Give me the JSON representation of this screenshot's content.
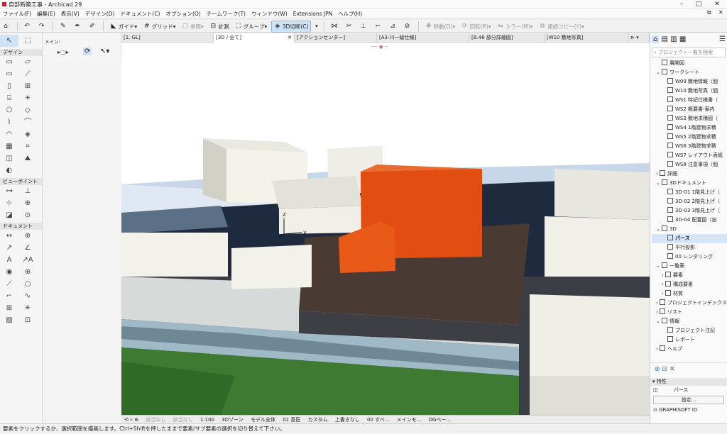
{
  "window": {
    "title": "自部新築工事 - Archicad 29",
    "min": "–",
    "max": "□",
    "close": "✕"
  },
  "menu": [
    "ファイル(F)",
    "編集(E)",
    "表示(V)",
    "デザイン(D)",
    "ドキュメント(C)",
    "オプション(O)",
    "チームワーク(T)",
    "ウィンドウ(W)",
    "Extensions JPN",
    "ヘルプ(H)"
  ],
  "toolbar": {
    "guide": "ガイド",
    "grid": "グリッド",
    "ref": "参照",
    "measure": "計測",
    "group": "グループ",
    "cut3d": "3D切断(C)",
    "move": "移動(D)",
    "rotate": "回転(R)",
    "mirror": "ミラー(M)",
    "copy": "連続コピー(Y)"
  },
  "left": {
    "info_label": "メイン:",
    "design": "デザイン",
    "viewpoint": "ビューポイント",
    "document": "ドキュメント"
  },
  "tabs": [
    {
      "label": "[1. GL]"
    },
    {
      "label": "[3D / 全て]"
    },
    {
      "label": "[アクションセンター]"
    },
    {
      "label": "[A3-川一級仕様]"
    },
    {
      "label": "[B.46 部分詳細図]"
    },
    {
      "label": "[W10 敷地写真]"
    }
  ],
  "axis": {
    "z": "Z",
    "x": "X",
    "y": "Y"
  },
  "navbar": {
    "none1": "該当なし",
    "none2": "該当なし",
    "scale": "1:100",
    "zone": "3Dゾーン",
    "model": "モデル全体",
    "floor": "01 意匠",
    "custom": "カスタム",
    "overwrite": "上書きなし",
    "all": "00 すべ...",
    "mem": "メインモ...",
    "og": "OGベー..."
  },
  "status": "要素をクリックするか、選択範囲を描画します。Ctrl+Shiftを押したままで要素/サブ要素の選択を切り替えて下さい。",
  "right": {
    "search": "プロジェクト一覧を検索",
    "items": [
      {
        "label": "展開図",
        "indent": 1
      },
      {
        "label": "ワークシート",
        "indent": 1
      },
      {
        "label": "W09 敷地情報（個",
        "indent": 2
      },
      {
        "label": "W10 敷地写真（個",
        "indent": 2
      },
      {
        "label": "WS1 特記仕様書（",
        "indent": 2
      },
      {
        "label": "WS2 概要書-案内",
        "indent": 2
      },
      {
        "label": "WS3 敷地求積図（",
        "indent": 2
      },
      {
        "label": "WS4 1階建物求積",
        "indent": 2
      },
      {
        "label": "WS5 2階建物求積",
        "indent": 2
      },
      {
        "label": "WS6 3階建物求積",
        "indent": 2
      },
      {
        "label": "WS7 レイアウト表紙",
        "indent": 2
      },
      {
        "label": "WS8 注意事項（個",
        "indent": 2
      },
      {
        "label": "詳細",
        "indent": 0
      },
      {
        "label": "3Dドキュメント",
        "indent": 0
      },
      {
        "label": "3D-01 1階見上げ（",
        "indent": 2
      },
      {
        "label": "3D-02 2階見上げ（",
        "indent": 2
      },
      {
        "label": "3D-03 3階見上げ（",
        "indent": 2
      },
      {
        "label": "3D-04 配置図（自",
        "indent": 2
      },
      {
        "label": "3D",
        "indent": 0
      },
      {
        "label": "パース",
        "indent": 1,
        "sel": true
      },
      {
        "label": "平行投影",
        "indent": 1
      },
      {
        "label": "00 レンダリング",
        "indent": 1
      },
      {
        "label": "一覧表",
        "indent": 0
      },
      {
        "label": "要素",
        "indent": 1
      },
      {
        "label": "構成要素",
        "indent": 1
      },
      {
        "label": "材質",
        "indent": 1
      },
      {
        "label": "プロジェクトインデックス",
        "indent": 0
      },
      {
        "label": "リスト",
        "indent": 0
      },
      {
        "label": "情報",
        "indent": 0
      },
      {
        "label": "プロジェクト注記",
        "indent": 1
      },
      {
        "label": "レポート",
        "indent": 1
      },
      {
        "label": "ヘルプ",
        "indent": 0
      }
    ],
    "props_title": "特性",
    "props_value": "パース",
    "settings": "設定...",
    "brand": "GRAPHISOFT ID"
  }
}
